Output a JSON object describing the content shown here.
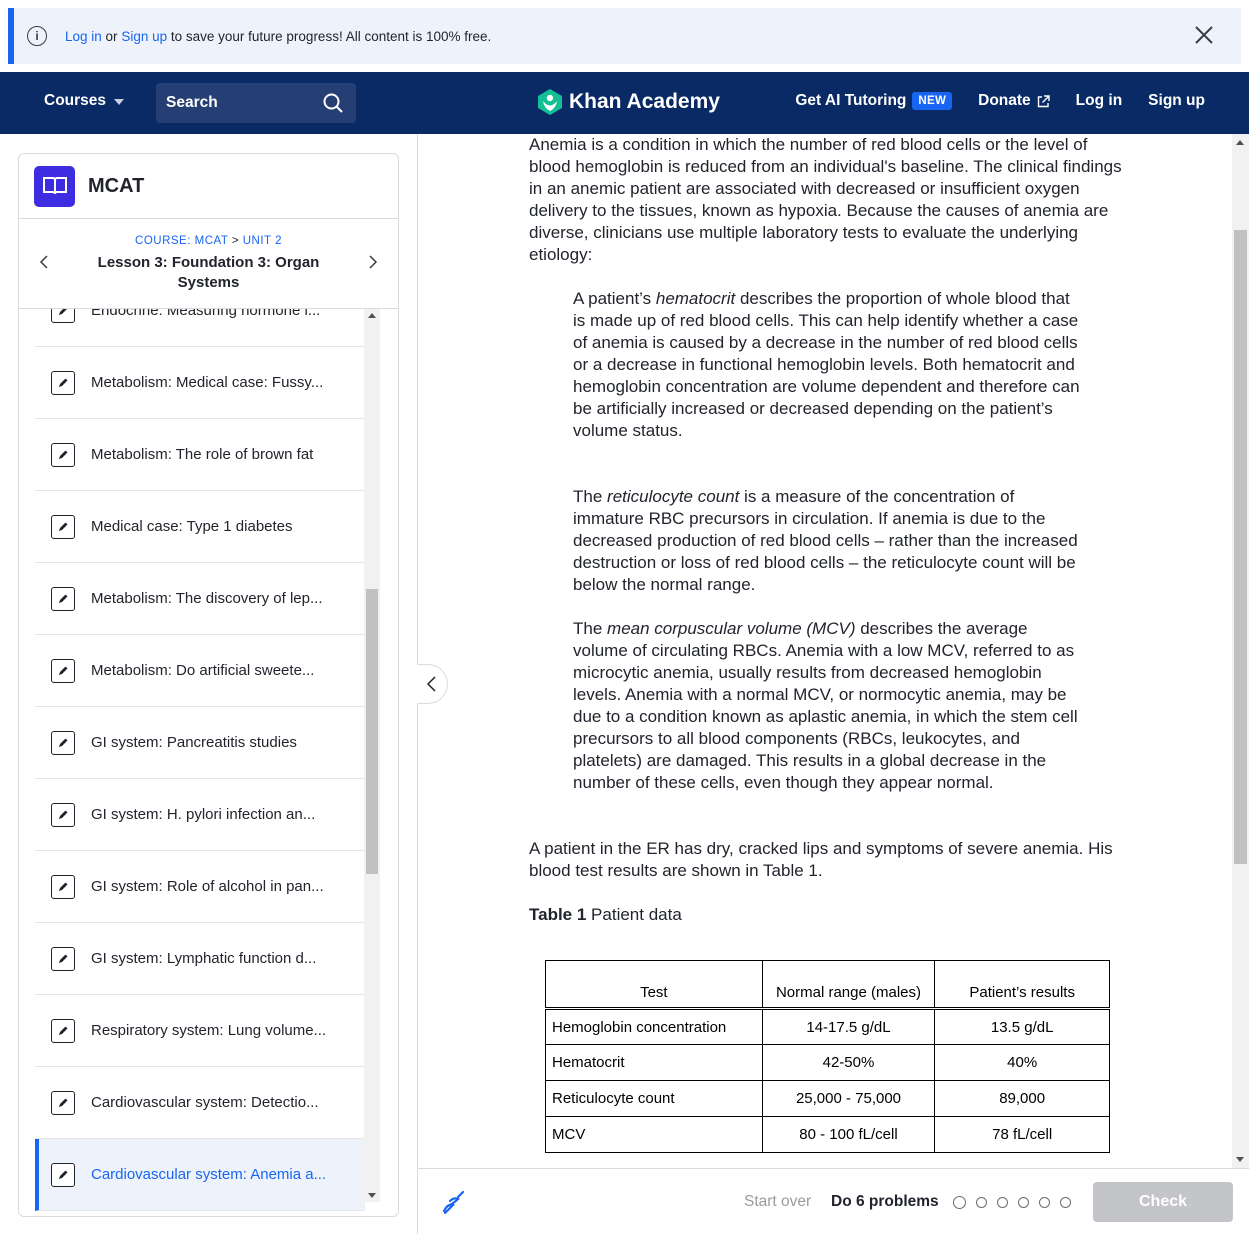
{
  "banner": {
    "login_text": "Log in",
    "or_text": " or ",
    "signup_text": "Sign up",
    "message": " to save your future progress! All content is 100% free."
  },
  "header": {
    "courses_label": "Courses",
    "search_placeholder": "Search",
    "logo_text": "Khan Academy",
    "ai_tutoring_label": "Get AI Tutoring",
    "new_badge": "NEW",
    "donate_label": "Donate",
    "login_label": "Log in",
    "signup_label": "Sign up"
  },
  "sidebar": {
    "course_title": "MCAT",
    "breadcrumb_course": "COURSE: MCAT",
    "breadcrumb_sep": " > ",
    "breadcrumb_unit": "UNIT 2",
    "lesson_title": "Lesson 3: Foundation 3: Organ Systems",
    "items": [
      {
        "label": "Endocrine: Measuring hormone l..."
      },
      {
        "label": "Metabolism: Medical case: Fussy..."
      },
      {
        "label": "Metabolism: The role of brown fat"
      },
      {
        "label": "Medical case: Type 1 diabetes"
      },
      {
        "label": "Metabolism: The discovery of lep..."
      },
      {
        "label": "Metabolism: Do artificial sweete..."
      },
      {
        "label": "GI system: Pancreatitis studies"
      },
      {
        "label": "GI system: H. pylori infection an..."
      },
      {
        "label": "GI system: Role of alcohol in pan..."
      },
      {
        "label": "GI system: Lymphatic function d..."
      },
      {
        "label": "Respiratory system: Lung volume..."
      },
      {
        "label": "Cardiovascular system: Detectio..."
      },
      {
        "label": "Cardiovascular system: Anemia a..."
      }
    ]
  },
  "content": {
    "p1": "Anemia is a condition in which the number of red blood cells or the level of blood hemoglobin is reduced from an individual's baseline. The clinical findings in an anemic patient are associated with decreased or insufficient oxygen delivery to the tissues, known as hypoxia. Because the causes of anemia are diverse, clinicians use multiple laboratory tests to evaluate the underlying etiology:",
    "p2_pre": "A patient’s ",
    "p2_em": "hematocrit",
    "p2_post": " describes the proportion of whole blood that is made up of red blood cells. This can help identify whether a case of anemia is caused by a decrease in the number of red blood cells or a decrease in functional hemoglobin levels. Both hematocrit and hemoglobin concentration are volume dependent and therefore can be artificially increased or decreased depending on the patient’s volume status.",
    "p3_pre": "The ",
    "p3_em": "reticulocyte count",
    "p3_post": " is a measure of the concentration of immature RBC precursors in circulation. If anemia is due to the decreased production of red blood cells – rather than the increased destruction or loss of red blood cells – the reticulocyte count will be below the normal range.",
    "p4_pre": "The ",
    "p4_em": "mean corpuscular volume (MCV)",
    "p4_post": " describes the average volume of circulating RBCs. Anemia with a low MCV, referred to as microcytic anemia, usually results from decreased hemoglobin levels. Anemia with a normal MCV, or normocytic anemia, may be due to a condition known as aplastic anemia, in which the stem cell precursors to all blood components (RBCs, leukocytes, and platelets) are damaged. This results in a global decrease in the number of these cells, even though they appear normal.",
    "p5": "A patient in the ER has dry, cracked lips and symptoms of severe anemia. His blood test results are shown in Table 1.",
    "caption_bold": "Table 1",
    "caption_rest": " Patient data"
  },
  "table": {
    "headers": [
      "Test",
      "Normal range (males)",
      "Patient’s results"
    ],
    "rows": [
      [
        "Hemoglobin concentration",
        "14-17.5 g/dL",
        "13.5 g/dL"
      ],
      [
        "Hematocrit",
        "42-50%",
        "40%"
      ],
      [
        "Reticulocyte count",
        "25,000 - 75,000",
        "89,000"
      ],
      [
        "MCV",
        "80 - 100 fL/cell",
        "78 fL/cell"
      ]
    ]
  },
  "footer": {
    "start_over": "Start over",
    "do_problems": "Do 6 problems",
    "check_label": "Check"
  },
  "colors": {
    "header_bg": "#0a2a66",
    "accent": "#1865f2",
    "course_icon": "#3d2ce0",
    "logo_green": "#14bf96"
  },
  "icons": [
    "info-icon",
    "close-icon",
    "chevron-down-icon",
    "search-icon",
    "khan-logo-icon",
    "external-link-icon",
    "book-icon",
    "chevron-left-icon",
    "chevron-right-icon",
    "exercise-pencil-icon",
    "scratchpad-icon"
  ]
}
